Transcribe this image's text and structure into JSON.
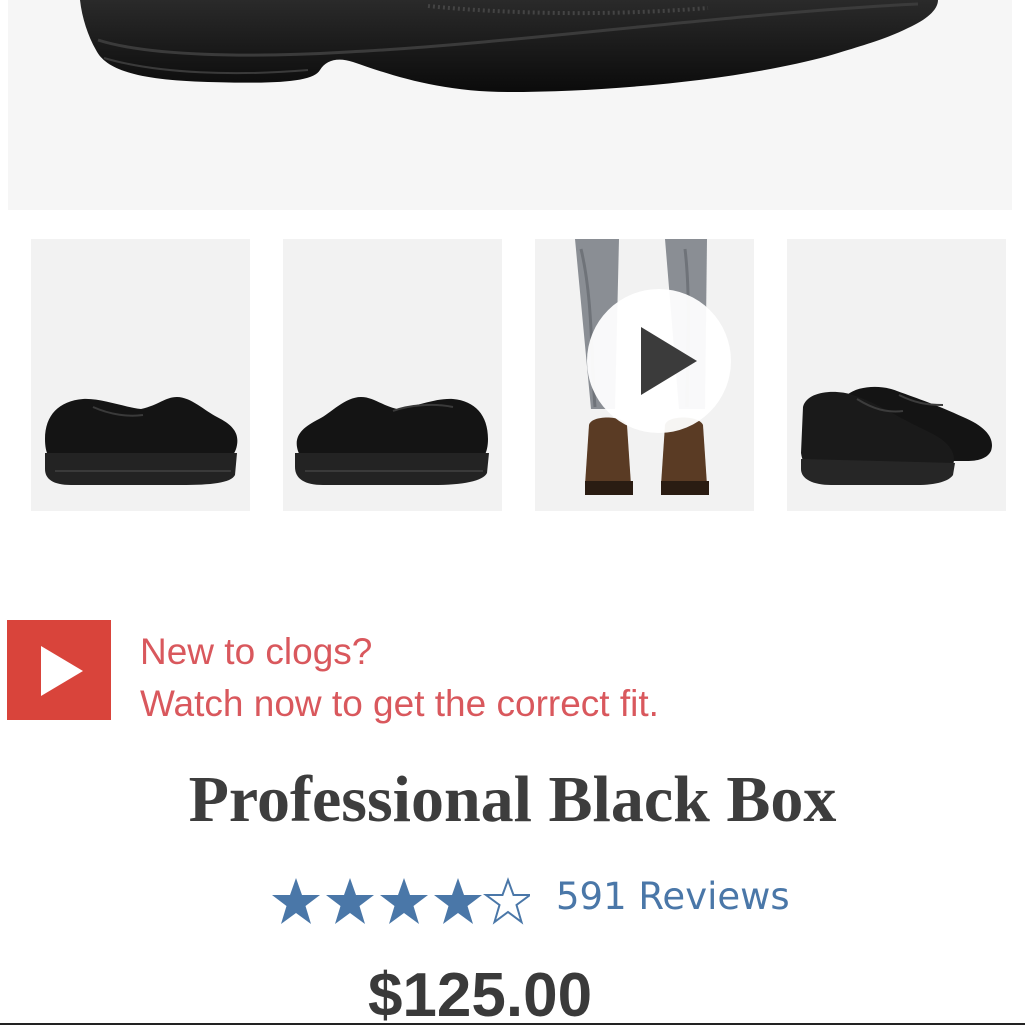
{
  "hero": {
    "image": "black-clog-closeup"
  },
  "thumbnails": [
    {
      "image": "clog-side-view",
      "kind": "photo"
    },
    {
      "image": "clog-other-side-view",
      "kind": "photo"
    },
    {
      "image": "model-wearing-clogs",
      "kind": "video",
      "overlay_icon": "play-icon"
    },
    {
      "image": "clog-pair-view",
      "kind": "photo"
    }
  ],
  "fit_banner": {
    "icon": "video-play-icon",
    "line1": "New to clogs?",
    "line2": "Watch now to get the correct fit.",
    "color": "#d9585d",
    "icon_color": "#d9443b"
  },
  "product": {
    "title": "Professional Black Box",
    "rating": 4,
    "rating_max": 5,
    "reviews_label": "591 Reviews",
    "price": "$125.00",
    "star_color": "#4a77a8"
  }
}
